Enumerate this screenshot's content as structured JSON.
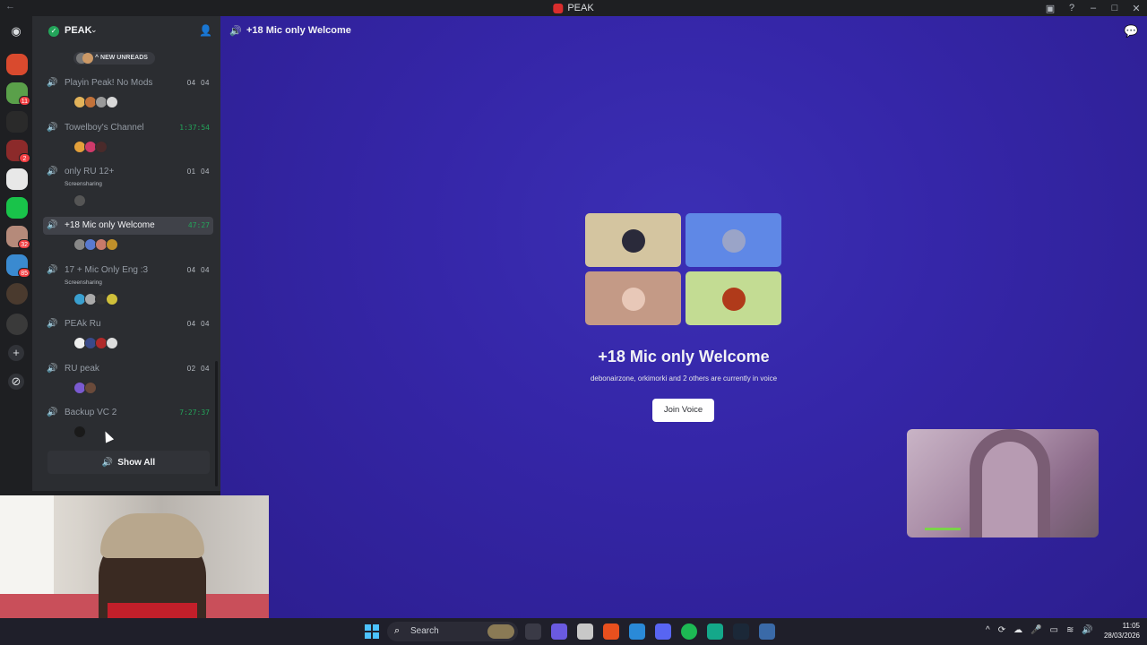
{
  "window": {
    "title": "PEAK"
  },
  "server": {
    "name": "PEAK"
  },
  "unreads": {
    "label": "NEW UNREADS"
  },
  "rail": {
    "badges": [
      "11",
      "2",
      "32",
      "85"
    ]
  },
  "channels": [
    {
      "name": "Playin Peak! No Mods",
      "count_a": "04",
      "count_b": "04"
    },
    {
      "name": "Towelboy's Channel",
      "timer": "1:37:54"
    },
    {
      "name": "only RU 12+",
      "status": "Screensharing",
      "count_a": "01",
      "count_b": "04"
    },
    {
      "name": "+18 Mic only Welcome",
      "timer": "47:27"
    },
    {
      "name": "17 + Mic Only Eng :3",
      "status": "Screensharing",
      "count_a": "04",
      "count_b": "04"
    },
    {
      "name": "PEAk Ru",
      "count_a": "04",
      "count_b": "04"
    },
    {
      "name": "RU peak",
      "count_a": "02",
      "count_b": "04"
    },
    {
      "name": "Backup VC 2",
      "timer": "7:27:37"
    }
  ],
  "show_all": {
    "label": "Show All"
  },
  "main": {
    "header_title": "+18 Mic only Welcome",
    "voice_title": "+18 Mic only Welcome",
    "voice_subtitle": "debonairzone, orkimorki and 2 others are currently in voice",
    "join_label": "Join Voice"
  },
  "taskbar": {
    "search_label": "Search",
    "time": "11:05",
    "date": "28/03/2026"
  },
  "colors": {
    "online_green": "#23a55a",
    "accent_purple": "#3526a8",
    "tile_colors": [
      "#d4c5a0",
      "#5f88e6",
      "#c49a86",
      "#c3dc93"
    ]
  }
}
